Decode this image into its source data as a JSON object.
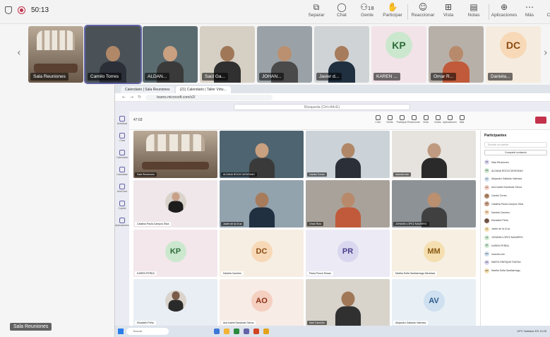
{
  "meeting": {
    "timer": "50:13"
  },
  "toolbar": [
    {
      "label": "Separar",
      "icon": "pop-out-icon",
      "glyph": "⧉"
    },
    {
      "label": "Chat",
      "icon": "chat-icon",
      "glyph": "◯"
    },
    {
      "label": "Gente",
      "icon": "people-icon",
      "glyph": "⚇",
      "badge": "18"
    },
    {
      "label": "Participar",
      "icon": "raise-hand-icon",
      "glyph": "✋"
    },
    {
      "label": "Reaccionar",
      "icon": "react-icon",
      "glyph": "☺"
    },
    {
      "label": "Vista",
      "icon": "view-icon",
      "glyph": "⊞"
    },
    {
      "label": "Notas",
      "icon": "notes-icon",
      "glyph": "▤"
    },
    {
      "label": "Aplicaciones",
      "icon": "apps-icon",
      "glyph": "⊕"
    },
    {
      "label": "Más",
      "icon": "more-icon",
      "glyph": "⋯"
    },
    {
      "label": "Cámara",
      "icon": "camera-icon",
      "glyph": "▶"
    }
  ],
  "thumbnails": [
    {
      "name": "Sala Reuniones",
      "type": "room",
      "bg": "#8a7a6a"
    },
    {
      "name": "Camilo Torres",
      "type": "video",
      "bg": "#4a5258",
      "skin": "#b08868",
      "shirt": "#2b2f38",
      "selected": true
    },
    {
      "name": "ALDAN...",
      "type": "video",
      "bg": "#5a6b70",
      "skin": "#c9a080",
      "shirt": "#3a3a3a"
    },
    {
      "name": "Saúl Ga...",
      "type": "video",
      "bg": "#d6d0c4",
      "skin": "#a07858",
      "shirt": "#303030"
    },
    {
      "name": "JOHAN...",
      "type": "video",
      "bg": "#9aa2a8",
      "skin": "#ba9070",
      "shirt": "#4a4a4a"
    },
    {
      "name": "Javier d...",
      "type": "video",
      "bg": "#cfd3d6",
      "skin": "#a67c5c",
      "shirt": "#203040"
    },
    {
      "name": "KAREN ...",
      "type": "avatar",
      "initials": "KP",
      "bg": "#f2e3e8",
      "avatar_bg": "#cbe8cf",
      "avatar_fg": "#2f6b3a"
    },
    {
      "name": "Omar R...",
      "type": "video",
      "bg": "#b7b0a8",
      "skin": "#b88a6c",
      "shirt": "#c05a3a"
    },
    {
      "name": "Daniela...",
      "type": "avatar",
      "initials": "DC",
      "bg": "#f5ecdf",
      "avatar_bg": "#f7d9b8",
      "avatar_fg": "#8a4b13"
    }
  ],
  "browser": {
    "tabs": [
      "Calendario | Sala Reuniones",
      "(21) Calendario | Taller Virtu..."
    ],
    "url": "teams.microsoft.com/v2/",
    "search_placeholder": "Búsqueda (Ctrl+Alt+E)",
    "meeting_title": "47:03",
    "rail": [
      "Actividad",
      "Chat",
      "Calendario",
      "Llamadas",
      "OneDrive",
      "Copilot",
      "Aplicaciones"
    ],
    "meeting_tools": [
      "Chat",
      "Gente",
      "Participar",
      "Reaccionar",
      "Vista",
      "Notas",
      "Aplicaciones",
      "Más"
    ]
  },
  "grid": [
    {
      "name": "Sala Reuniones",
      "type": "room",
      "bg": "#7d6c5e"
    },
    {
      "name": "ALDANA ROCIO MONTANO",
      "type": "video",
      "bg": "#4e6470",
      "skin": "#c9a080",
      "shirt": "#3a3a3a"
    },
    {
      "name": "Camilo Torres",
      "type": "video",
      "bg": "#cbd3d8",
      "skin": "#b08868",
      "shirt": "#2b2f38"
    },
    {
      "name": "marcelo nilo",
      "type": "video",
      "bg": "#e6e3de",
      "skin": "#bf9a80",
      "shirt": "#2a2a2a"
    },
    {
      "name": "Catalina Paola Campos Silva",
      "type": "photo",
      "bg": "#efe7e9",
      "skin": "#c8a088",
      "shirt": "#1d1d1d"
    },
    {
      "name": "Javier de la Cruz",
      "type": "video",
      "bg": "#93a3ae",
      "skin": "#a67c5c",
      "shirt": "#203040"
    },
    {
      "name": "Omar Ríos",
      "type": "video",
      "bg": "#a9a29a",
      "skin": "#b88a6c",
      "shirt": "#c05a3a"
    },
    {
      "name": "JOHANN LOPEZ NAVARRO",
      "type": "video",
      "bg": "#8d9296",
      "skin": "#ba9070",
      "shirt": "#404040"
    },
    {
      "name": "KAREN PEREA",
      "type": "avatar",
      "initials": "KP",
      "bg": "#f3e7eb",
      "avatar_bg": "#cbe8cf",
      "avatar_fg": "#2f6b3a"
    },
    {
      "name": "Daniela Caceres",
      "type": "avatar",
      "initials": "DC",
      "bg": "#f6eee3",
      "avatar_bg": "#f7d9b8",
      "avatar_fg": "#8a4b13"
    },
    {
      "name": "Paula Ponce Rosas",
      "type": "avatar",
      "initials": "PR",
      "bg": "#eceaf5",
      "avatar_bg": "#d9d6f0",
      "avatar_fg": "#4a3f8a"
    },
    {
      "name": "Martha Sofia Santiaerrago Mendoza",
      "type": "avatar",
      "initials": "MM",
      "bg": "#f6efe2",
      "avatar_bg": "#f5dfb0",
      "avatar_fg": "#8a5a13"
    },
    {
      "name": "Elizabeth Peña",
      "type": "photo",
      "bg": "#e8eef3",
      "skin": "#7a5a48",
      "shirt": "#2a2a2a"
    },
    {
      "name": "Ana Isabel Sandoval Ochoa",
      "type": "avatar",
      "initials": "AO",
      "bg": "#f7ece6",
      "avatar_bg": "#f5cfc0",
      "avatar_fg": "#8a2f13"
    },
    {
      "name": "Saúl Garduño",
      "type": "video",
      "bg": "#d8d4cc",
      "skin": "#a07858",
      "shirt": "#303030"
    },
    {
      "name": "Alejandro Gallardo Valencia",
      "type": "avatar",
      "initials": "AV",
      "bg": "#e8f0f6",
      "avatar_bg": "#cfe0f0",
      "avatar_fg": "#2b5b8a"
    }
  ],
  "participants_panel": {
    "title": "Participantes",
    "invite_placeholder": "Escribir un nombre",
    "share_invite": "Compartir invitación",
    "people": [
      {
        "name": "Sala Reuniones",
        "initials": "SR",
        "color": "#d9d6f0"
      },
      {
        "name": "ALDANA ROCIO MONTANO",
        "initials": "AM",
        "color": "#cbe8cf"
      },
      {
        "name": "Alejandro Gallardo Valencia",
        "initials": "AV",
        "color": "#cfe0f0"
      },
      {
        "name": "Ana Isabel Sandoval Ochoa",
        "initials": "AO",
        "color": "#f5cfc0"
      },
      {
        "name": "Camilo Torres",
        "initials": "CT",
        "color": "#b08868"
      },
      {
        "name": "Catalina Paola Campos Silva",
        "initials": "CS",
        "color": "#c8a088"
      },
      {
        "name": "Daniela Caceres",
        "initials": "DC",
        "color": "#f7d9b8"
      },
      {
        "name": "Elizabeth Peña",
        "initials": "EP",
        "color": "#7a5a48"
      },
      {
        "name": "Javier de la Cruz",
        "initials": "JC",
        "color": "#f5dfb0"
      },
      {
        "name": "JOHANN LOPEZ NAVARRO",
        "initials": "JN",
        "color": "#cbe8cf"
      },
      {
        "name": "KAREN PEREA",
        "initials": "KP",
        "color": "#cbe8cf"
      },
      {
        "name": "marcelo nilo",
        "initials": "MN",
        "color": "#cfe0f0"
      },
      {
        "name": "MARIO ENRIQUE RUEDA",
        "initials": "MR",
        "color": "#d9d6f0"
      },
      {
        "name": "Martha Sofia Santiaerrago",
        "initials": "MM",
        "color": "#f5dfb0"
      }
    ]
  },
  "taskbar": {
    "search": "Buscar",
    "tray": "UPC Nublado  ES  11:05"
  },
  "bottom_label": "Sala Reuniones"
}
